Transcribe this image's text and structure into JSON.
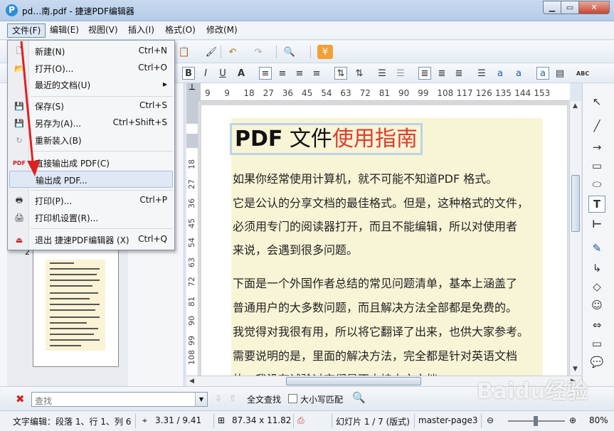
{
  "window": {
    "title": "pd…南.pdf - 捷速PDF编辑器"
  },
  "menubar": [
    "文件(F)",
    "编辑(E)",
    "视图(V)",
    "插入(I)",
    "格式(O)",
    "修改(M)"
  ],
  "file_menu": [
    {
      "label": "新建(N)",
      "shortcut": "Ctrl+N",
      "icon": "new-doc-icon"
    },
    {
      "label": "打开(O)...",
      "shortcut": "Ctrl+O",
      "icon": "open-folder-icon"
    },
    {
      "label": "最近的文档(U)",
      "shortcut": "▸",
      "icon": ""
    },
    {
      "label": "保存(S)",
      "shortcut": "Ctrl+S",
      "icon": "save-icon"
    },
    {
      "label": "另存为(A)...",
      "shortcut": "Ctrl+Shift+S",
      "icon": "save-as-icon"
    },
    {
      "label": "重新装入(B)",
      "shortcut": "",
      "icon": "reload-icon"
    },
    {
      "label": "直接输出成 PDF(C)",
      "shortcut": "",
      "icon": "pdf-export-icon"
    },
    {
      "label": "输出成 PDF...",
      "shortcut": "",
      "icon": ""
    },
    {
      "label": "打印(P)...",
      "shortcut": "Ctrl+P",
      "icon": "print-icon"
    },
    {
      "label": "打印机设置(R)...",
      "shortcut": "",
      "icon": "printer-settings-icon"
    },
    {
      "label": "退出 捷速PDF编辑器 (X)",
      "shortcut": "Ctrl+Q",
      "icon": "exit-icon"
    }
  ],
  "ruler": {
    "h_labels": [
      "9",
      "9",
      "18",
      "27",
      "36",
      "45",
      "54",
      "63",
      "72",
      "81",
      "90",
      "99",
      "108",
      "117",
      "126",
      "135",
      "144",
      "153"
    ],
    "v_labels": [
      "18",
      "27",
      "36",
      "45",
      "54",
      "63",
      "72",
      "81",
      "90",
      "99",
      "108"
    ]
  },
  "sidebar": {
    "page_number": "2"
  },
  "document": {
    "title_bold": "PDF",
    "title_normal": " 文件",
    "title_red": "使用指南",
    "paragraphs": [
      "如果你经常使用计算机，就不可能不知道PDF 格式。",
      "它是公认的分享文档的最佳格式。但是，这种格式的文件，",
      "必须用专门的阅读器打开，而且不能编辑，所以对使用者",
      "来说，会遇到很多问题。",
      "下面是一个外国作者总结的常见问题清单，基本上涵盖了",
      "普通用户的大多数问题，而且解决方法全部都是免费的。",
      "我觉得对我很有用，所以将它翻译了出来，也供大家参考。",
      "需要说明的是，里面的解决方法，完全都是针对英语文档",
      "的。我没有试验过它们是否支持中文文档。"
    ]
  },
  "findbar": {
    "placeholder": "查找",
    "find_all": "全文查找",
    "match_case": "大小写匹配"
  },
  "status": {
    "edit": "文字编辑：段落 1、行 1、列 6",
    "position": "3.31 / 9.41",
    "size": "87.34 x 11.82",
    "slide": "幻灯片 1 / 7 (版式)",
    "master": "master-page3",
    "zoom": "80%"
  },
  "watermark": "Baidu经验",
  "colors": {
    "accent_red": "#e03a2c",
    "highlight_bg": "#f8f4d6",
    "annotation_arrow": "#e02020"
  }
}
